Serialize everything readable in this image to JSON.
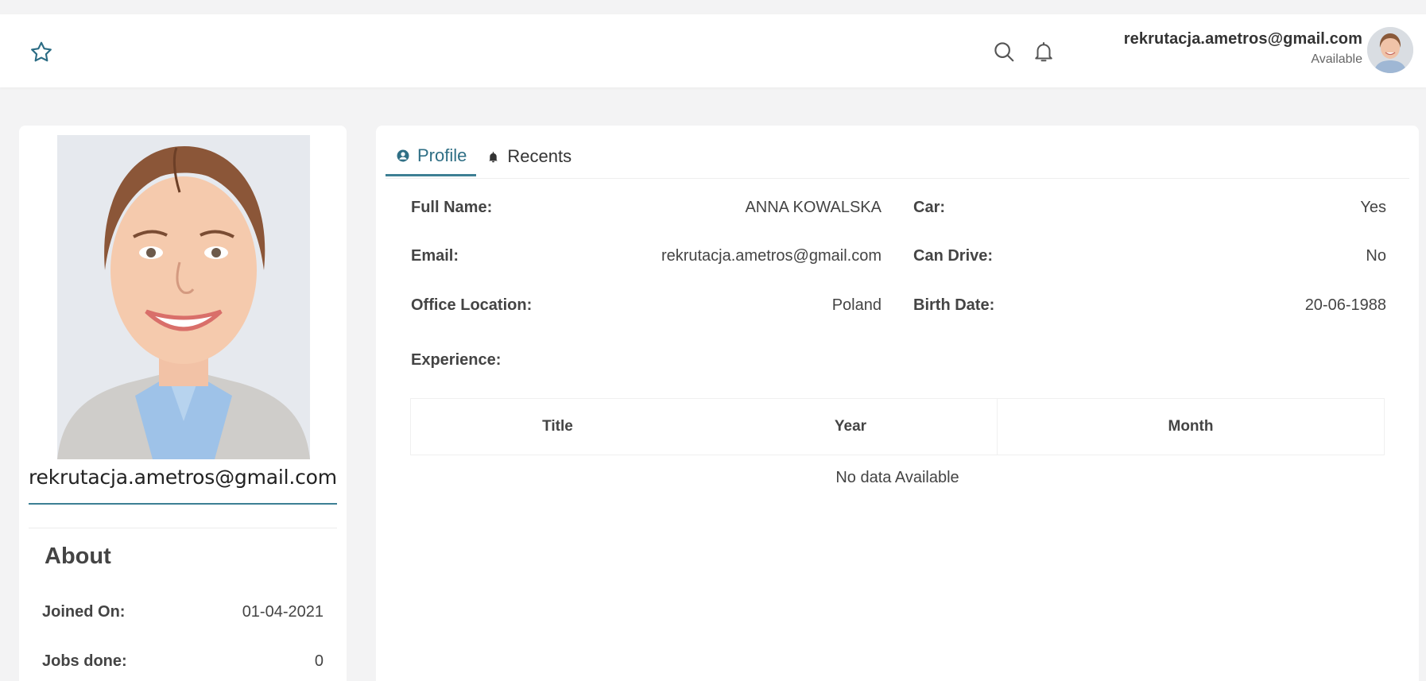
{
  "topbar": {
    "favorite_icon": "star-outline-icon",
    "search_icon": "search-icon",
    "notifications_icon": "bell-icon",
    "user_email": "rekrutacja.ametros@gmail.com",
    "user_status": "Available"
  },
  "profile_card": {
    "email": "rekrutacja.ametros@gmail.com",
    "about_title": "About",
    "about": [
      {
        "label": "Joined On:",
        "value": "01-04-2021"
      },
      {
        "label": "Jobs done:",
        "value": "0"
      }
    ]
  },
  "tabs": [
    {
      "label": "Profile",
      "icon": "user-circle-icon",
      "active": true
    },
    {
      "label": "Recents",
      "icon": "bell-icon",
      "active": false
    }
  ],
  "details": {
    "full_name": {
      "label": "Full Name:",
      "value": "ANNA KOWALSKA"
    },
    "email": {
      "label": "Email:",
      "value": "rekrutacja.ametros@gmail.com"
    },
    "office_location": {
      "label": "Office Location:",
      "value": "Poland"
    },
    "car": {
      "label": "Car:",
      "value": "Yes"
    },
    "can_drive": {
      "label": "Can Drive:",
      "value": "No"
    },
    "birth_date": {
      "label": "Birth Date:",
      "value": "20-06-1988"
    },
    "experience_label": "Experience:"
  },
  "experience_table": {
    "columns": [
      "Title",
      "Year",
      "Month"
    ],
    "empty_text": "No data Available"
  },
  "colors": {
    "accent": "#3d7f94",
    "background": "#f3f3f4",
    "card": "#ffffff"
  }
}
